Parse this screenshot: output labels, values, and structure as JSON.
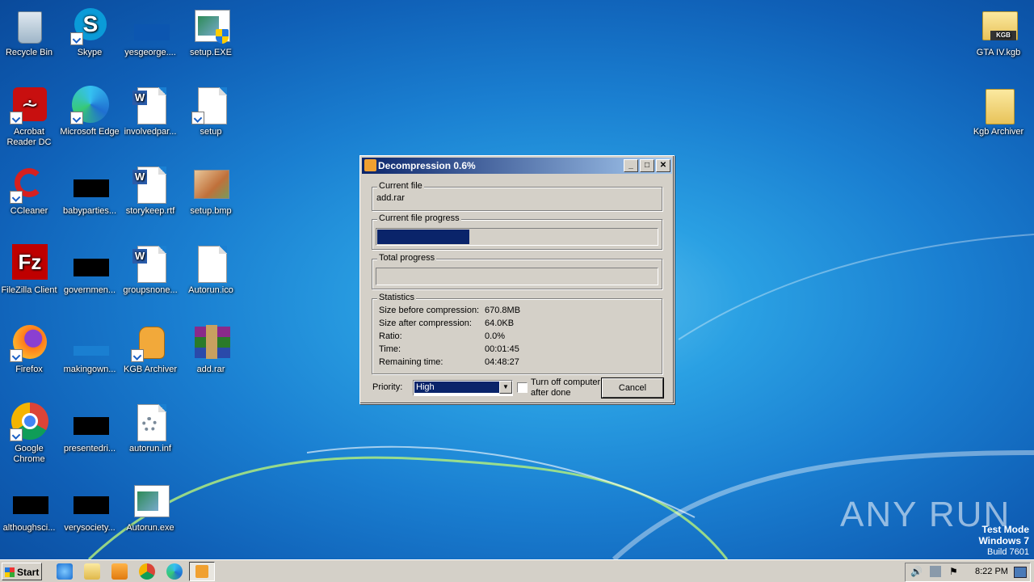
{
  "desktop": {
    "icons": [
      {
        "label": "Recycle Bin"
      },
      {
        "label": "Skype"
      },
      {
        "label": "yesgeorge...."
      },
      {
        "label": "setup.EXE"
      },
      {
        "label": "Acrobat Reader DC"
      },
      {
        "label": "Microsoft Edge"
      },
      {
        "label": "involvedpar..."
      },
      {
        "label": "setup"
      },
      {
        "label": "CCleaner"
      },
      {
        "label": "babyparties..."
      },
      {
        "label": "storykeep.rtf"
      },
      {
        "label": "setup.bmp"
      },
      {
        "label": "FileZilla Client"
      },
      {
        "label": "governmen..."
      },
      {
        "label": "groupsnone..."
      },
      {
        "label": "Autorun.ico"
      },
      {
        "label": "Firefox"
      },
      {
        "label": "makingown..."
      },
      {
        "label": "KGB Archiver"
      },
      {
        "label": "add.rar"
      },
      {
        "label": "Google Chrome"
      },
      {
        "label": "presentedri..."
      },
      {
        "label": "autorun.inf"
      },
      {
        "label": "althoughsci..."
      },
      {
        "label": "verysociety..."
      },
      {
        "label": "Autorun.exe"
      },
      {
        "label": "GTA IV.kgb"
      },
      {
        "label": "Kgb Archiver"
      }
    ],
    "watermark": {
      "brand": "ANY RUN",
      "mode": "Test Mode",
      "os": "Windows 7",
      "build": "Build 7601"
    }
  },
  "dialog": {
    "title": "Decompression 0.6%",
    "current_file_label": "Current file",
    "current_file": "add.rar",
    "current_progress_label": "Current file progress",
    "current_progress_fraction": 0.33,
    "total_progress_label": "Total progress",
    "total_progress_fraction": 0.0,
    "statistics_label": "Statistics",
    "stats": [
      {
        "label": "Size before compression:",
        "value": "670.8MB"
      },
      {
        "label": "Size after compression:",
        "value": "64.0KB"
      },
      {
        "label": "Ratio:",
        "value": "0.0%"
      },
      {
        "label": "Time:",
        "value": "00:01:45"
      },
      {
        "label": "Remaining time:",
        "value": "04:48:27"
      }
    ],
    "priority_label": "Priority:",
    "priority_value": "High",
    "shutdown_label_1": "Turn off computer",
    "shutdown_label_2": "after done",
    "cancel_label": "Cancel"
  },
  "taskbar": {
    "start_label": "Start",
    "clock": "8:22 PM"
  }
}
